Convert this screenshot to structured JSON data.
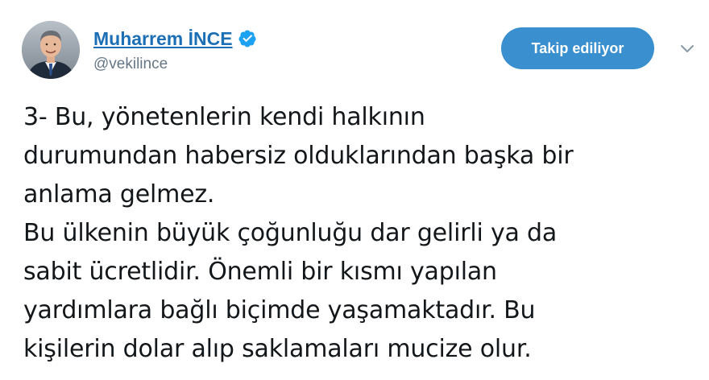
{
  "author": {
    "display_name": "Muharrem İNCE",
    "handle": "@vekilince",
    "verified": true,
    "avatar_icon": "profile-photo"
  },
  "actions": {
    "follow_label": "Takip ediliyor",
    "menu_icon": "chevron-down-icon"
  },
  "colors": {
    "name": "#1c6fb5",
    "verified_badge": "#1da1f2",
    "follow_button": "#3a8fcf",
    "handle": "#657786",
    "text": "#14171a"
  },
  "tweet": {
    "lines": [
      "3- Bu, yönetenlerin kendi halkının",
      "durumundan habersiz olduklarından başka bir",
      "anlama gelmez.",
      "Bu ülkenin büyük çoğunluğu dar gelirli ya da",
      "sabit ücretlidir. Önemli bir kısmı yapılan",
      "yardımlara bağlı biçimde yaşamaktadır. Bu",
      "kişilerin dolar alıp saklamaları mucize olur."
    ]
  }
}
